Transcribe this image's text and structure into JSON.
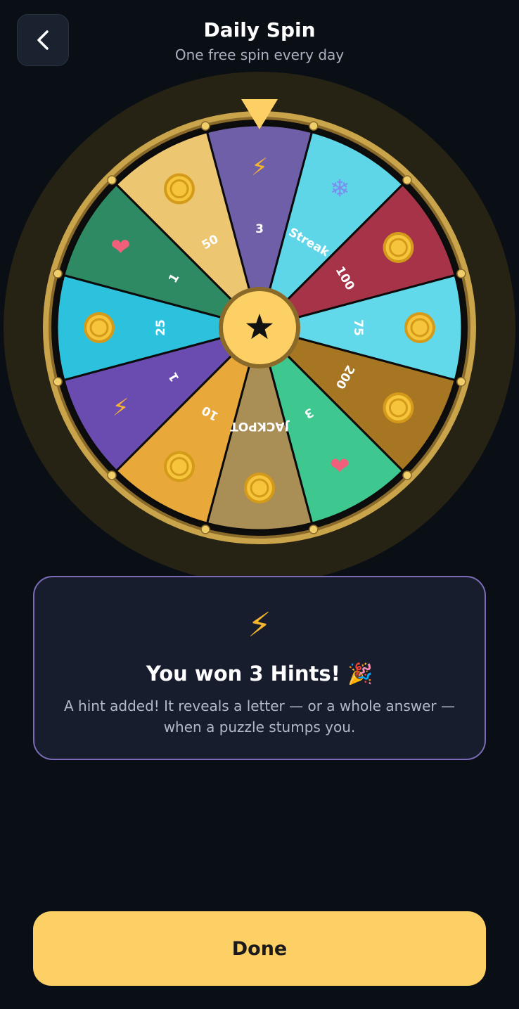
{
  "header": {
    "title": "Daily Spin",
    "subtitle": "One free spin every day",
    "back_icon": "chevron-left-icon"
  },
  "wheel": {
    "segments": [
      {
        "label": "3",
        "icon": "lightning-icon",
        "glyph": "⚡",
        "color": "#6f5ea8"
      },
      {
        "label": "Streak",
        "icon": "snowflake-icon",
        "glyph": "❄",
        "color": "#5fd6e8"
      },
      {
        "label": "100",
        "icon": "coin-icon",
        "glyph": "",
        "color": "#a63347"
      },
      {
        "label": "75",
        "icon": "coin-icon",
        "glyph": "",
        "color": "#62d9ea"
      },
      {
        "label": "200",
        "icon": "coin-icon",
        "glyph": "",
        "color": "#a67622"
      },
      {
        "label": "3",
        "icon": "heart-icon",
        "glyph": "❤",
        "color": "#3ec890"
      },
      {
        "label": "JACKPOT",
        "icon": "coin-icon",
        "glyph": "",
        "color": "#a98e55"
      },
      {
        "label": "10",
        "icon": "coin-icon",
        "glyph": "",
        "color": "#e8a83a"
      },
      {
        "label": "1",
        "icon": "lightning-icon",
        "glyph": "⚡",
        "color": "#6a4cb0"
      },
      {
        "label": "25",
        "icon": "coin-icon",
        "glyph": "",
        "color": "#2cc2de"
      },
      {
        "label": "1",
        "icon": "heart-icon",
        "glyph": "❤",
        "color": "#2e8a63"
      },
      {
        "label": "50",
        "icon": "coin-icon",
        "glyph": "",
        "color": "#ecc671"
      }
    ],
    "center_icon": "star-icon",
    "pointer_icon": "pointer-triangle-icon",
    "rim_color": "#c9a44b",
    "outer_color": "#262214"
  },
  "result": {
    "icon": "lightning-icon",
    "glyph": "⚡",
    "title": "You won 3 Hints! 🎉",
    "description": "A hint added! It reveals a letter — or a whole answer — when a puzzle stumps you."
  },
  "footer": {
    "done_label": "Done"
  }
}
